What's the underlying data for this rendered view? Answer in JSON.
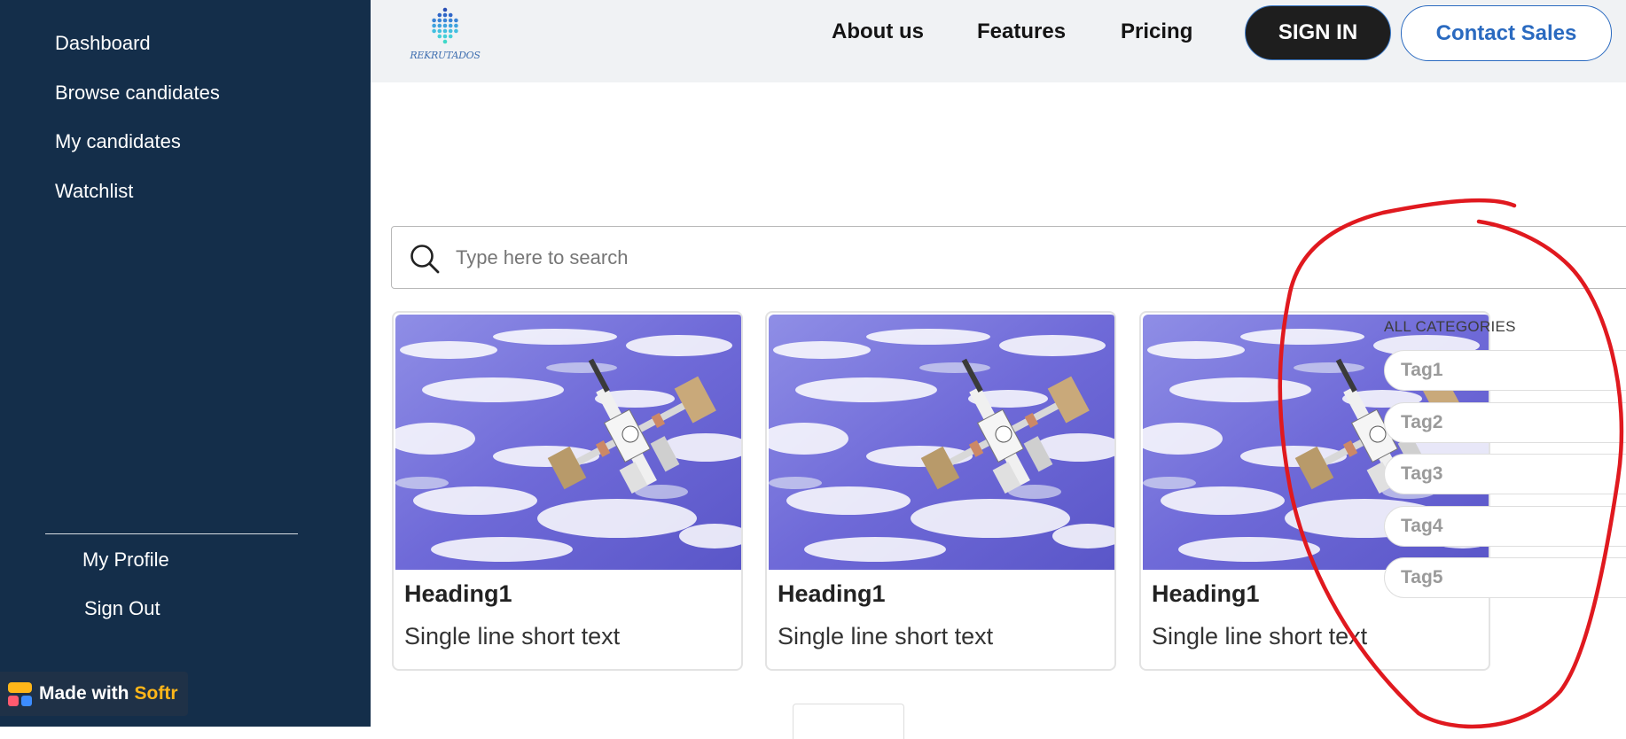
{
  "sidebar": {
    "items": [
      {
        "label": "Dashboard"
      },
      {
        "label": "Browse candidates"
      },
      {
        "label": "My candidates"
      },
      {
        "label": "Watchlist"
      }
    ],
    "profile_label": "My Profile",
    "signout_label": "Sign Out"
  },
  "badge": {
    "made_with": "Made with",
    "brand": "Softr",
    "brand_color": "#ffb619"
  },
  "header": {
    "logo_text": "REKRUTADOS",
    "nav": [
      {
        "label": "About us"
      },
      {
        "label": "Features"
      },
      {
        "label": "Pricing"
      }
    ],
    "signin_label": "SIGN IN",
    "contact_label": "Contact Sales"
  },
  "search": {
    "placeholder": "Type here to search",
    "value": ""
  },
  "cards": [
    {
      "heading": "Heading1",
      "text": "Single line short text"
    },
    {
      "heading": "Heading1",
      "text": "Single line short text"
    },
    {
      "heading": "Heading1",
      "text": "Single line short text"
    }
  ],
  "categories": {
    "title": "ALL CATEGORIES",
    "tags": [
      {
        "label": "Tag1"
      },
      {
        "label": "Tag2"
      },
      {
        "label": "Tag3"
      },
      {
        "label": "Tag4"
      },
      {
        "label": "Tag5"
      }
    ]
  },
  "colors": {
    "sidebar_bg": "#142e4a",
    "accent": "#2a6ac0",
    "annotation": "#e0191f"
  },
  "icons": [
    "search-icon",
    "softr-logo-icon",
    "company-logo-icon"
  ]
}
